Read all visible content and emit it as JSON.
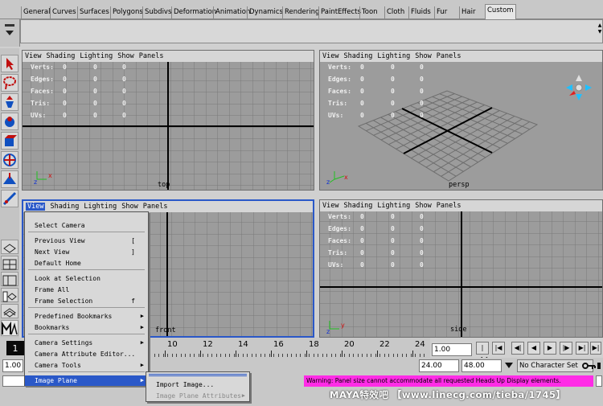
{
  "shelf": {
    "tabs": [
      "General",
      "Curves",
      "Surfaces",
      "Polygons",
      "Subdivs",
      "Deformation",
      "Animation",
      "Dynamics",
      "Rendering",
      "PaintEffects",
      "Toon",
      "Cloth",
      "Fluids",
      "Fur",
      "Hair",
      "Custom"
    ],
    "active_tab": "Custom"
  },
  "panel_menu": [
    "View",
    "Shading",
    "Lighting",
    "Show",
    "Panels"
  ],
  "hud": {
    "labels": [
      "Verts:",
      "Edges:",
      "Faces:",
      "Tris:",
      "UVs:"
    ],
    "value": "0"
  },
  "panels": {
    "top": {
      "camera": "top"
    },
    "persp": {
      "camera": "persp"
    },
    "front": {
      "camera": "front"
    },
    "side": {
      "camera": "side"
    }
  },
  "view_menu": {
    "items": [
      {
        "label": "Select Camera",
        "key": "",
        "sub": false
      },
      {
        "label": "Previous View",
        "key": "[",
        "sub": false
      },
      {
        "label": "Next View",
        "key": "]",
        "sub": false
      },
      {
        "label": "Default Home",
        "key": "",
        "sub": false
      },
      {
        "label": "Look at Selection",
        "key": "",
        "sub": false
      },
      {
        "label": "Frame All",
        "key": "",
        "sub": false
      },
      {
        "label": "Frame Selection",
        "key": "f",
        "sub": false
      },
      {
        "label": "Predefined Bookmarks",
        "key": "",
        "sub": true
      },
      {
        "label": "Bookmarks",
        "key": "",
        "sub": true
      },
      {
        "label": "Camera Settings",
        "key": "",
        "sub": true
      },
      {
        "label": "Camera Attribute Editor...",
        "key": "",
        "sub": false
      },
      {
        "label": "Camera Tools",
        "key": "",
        "sub": true
      },
      {
        "label": "Image Plane",
        "key": "",
        "sub": true
      }
    ],
    "highlighted": "Image Plane"
  },
  "image_plane_menu": {
    "items": [
      {
        "label": "Import Image...",
        "enabled": true
      },
      {
        "label": "Image Plane Attributes",
        "enabled": false
      }
    ]
  },
  "timeline": {
    "current_frame": "1",
    "ticks": [
      "10",
      "12",
      "14",
      "16",
      "18",
      "20",
      "22",
      "24"
    ],
    "current_time_field": "1.00"
  },
  "range": {
    "start": "1.00",
    "end": "24.00",
    "anim_end": "48.00",
    "character_set": "No Character Set"
  },
  "status": {
    "warning": "Warning: Panel size cannot accommodate all requested Heads Up Display elements."
  },
  "watermark": "MAYA特效吧 【www.linecg.com/tieba/1745】",
  "colors": {
    "active_panel_border": "#2a58c8",
    "warning_bg": "#ff2ce6",
    "viewport_bg": "#9c9c9c"
  }
}
